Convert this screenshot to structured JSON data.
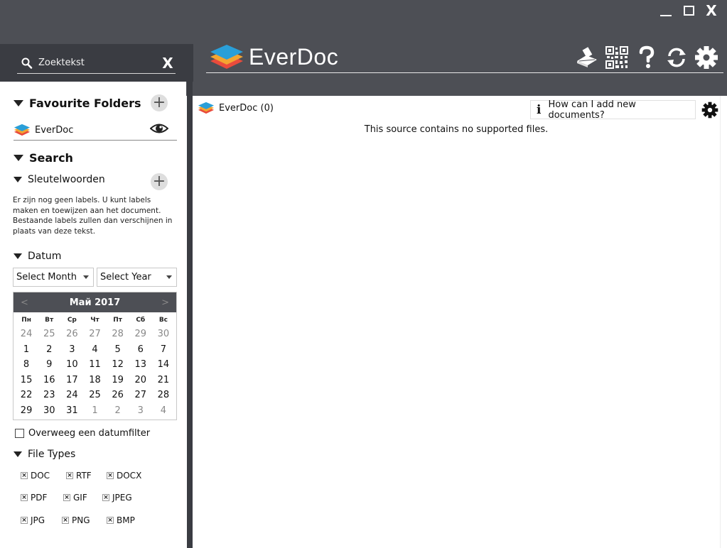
{
  "window": {
    "minimize_icon": "minimize-icon",
    "maximize_icon": "maximize-icon",
    "close_label": "X"
  },
  "search": {
    "placeholder": "Zoektekst",
    "clear_label": "X"
  },
  "brand": {
    "name": "EverDoc"
  },
  "toolbar": [
    "scanner-icon",
    "qr-code-icon",
    "help-icon",
    "refresh-icon",
    "settings-icon"
  ],
  "sidebar": {
    "favourites": {
      "title": "Favourite Folders",
      "folders": [
        {
          "name": "EverDoc"
        }
      ]
    },
    "search": {
      "title": "Search",
      "keywords": {
        "title": "Sleutelwoorden",
        "help": "Er zijn nog geen labels. U kunt labels maken en toewijzen aan het document. Bestaande labels zullen dan verschijnen in plaats van deze tekst."
      },
      "date": {
        "title": "Datum",
        "month_select": "Select Month",
        "year_select": "Select Year",
        "calendar": {
          "prev": "<",
          "next": ">",
          "title": "Май 2017",
          "weekdays": [
            "Пн",
            "Вт",
            "Ср",
            "Чт",
            "Пт",
            "Сб",
            "Вс"
          ],
          "days": [
            {
              "d": "24",
              "o": true
            },
            {
              "d": "25",
              "o": true
            },
            {
              "d": "26",
              "o": true
            },
            {
              "d": "27",
              "o": true
            },
            {
              "d": "28",
              "o": true
            },
            {
              "d": "29",
              "o": true
            },
            {
              "d": "30",
              "o": true
            },
            {
              "d": "1"
            },
            {
              "d": "2"
            },
            {
              "d": "3"
            },
            {
              "d": "4"
            },
            {
              "d": "5"
            },
            {
              "d": "6"
            },
            {
              "d": "7"
            },
            {
              "d": "8"
            },
            {
              "d": "9"
            },
            {
              "d": "10"
            },
            {
              "d": "11"
            },
            {
              "d": "12"
            },
            {
              "d": "13"
            },
            {
              "d": "14"
            },
            {
              "d": "15"
            },
            {
              "d": "16"
            },
            {
              "d": "17"
            },
            {
              "d": "18"
            },
            {
              "d": "19"
            },
            {
              "d": "20"
            },
            {
              "d": "21"
            },
            {
              "d": "22"
            },
            {
              "d": "23"
            },
            {
              "d": "24"
            },
            {
              "d": "25"
            },
            {
              "d": "26"
            },
            {
              "d": "27"
            },
            {
              "d": "28"
            },
            {
              "d": "29"
            },
            {
              "d": "30"
            },
            {
              "d": "31"
            },
            {
              "d": "1",
              "o": true
            },
            {
              "d": "2",
              "o": true
            },
            {
              "d": "3",
              "o": true
            },
            {
              "d": "4",
              "o": true
            }
          ]
        },
        "date_filter_label": "Overweeg een datumfilter"
      },
      "file_types": {
        "title": "File Types",
        "check_mark": "×",
        "items": [
          "DOC",
          "RTF",
          "DOCX",
          "PDF",
          "GIF",
          "JPEG",
          "JPG",
          "PNG",
          "BMP"
        ]
      }
    }
  },
  "main": {
    "source_label": "EverDoc (0)",
    "help_button": "How can I add new documents?",
    "help_icon": "i",
    "empty_message": "This source contains no supported files."
  }
}
